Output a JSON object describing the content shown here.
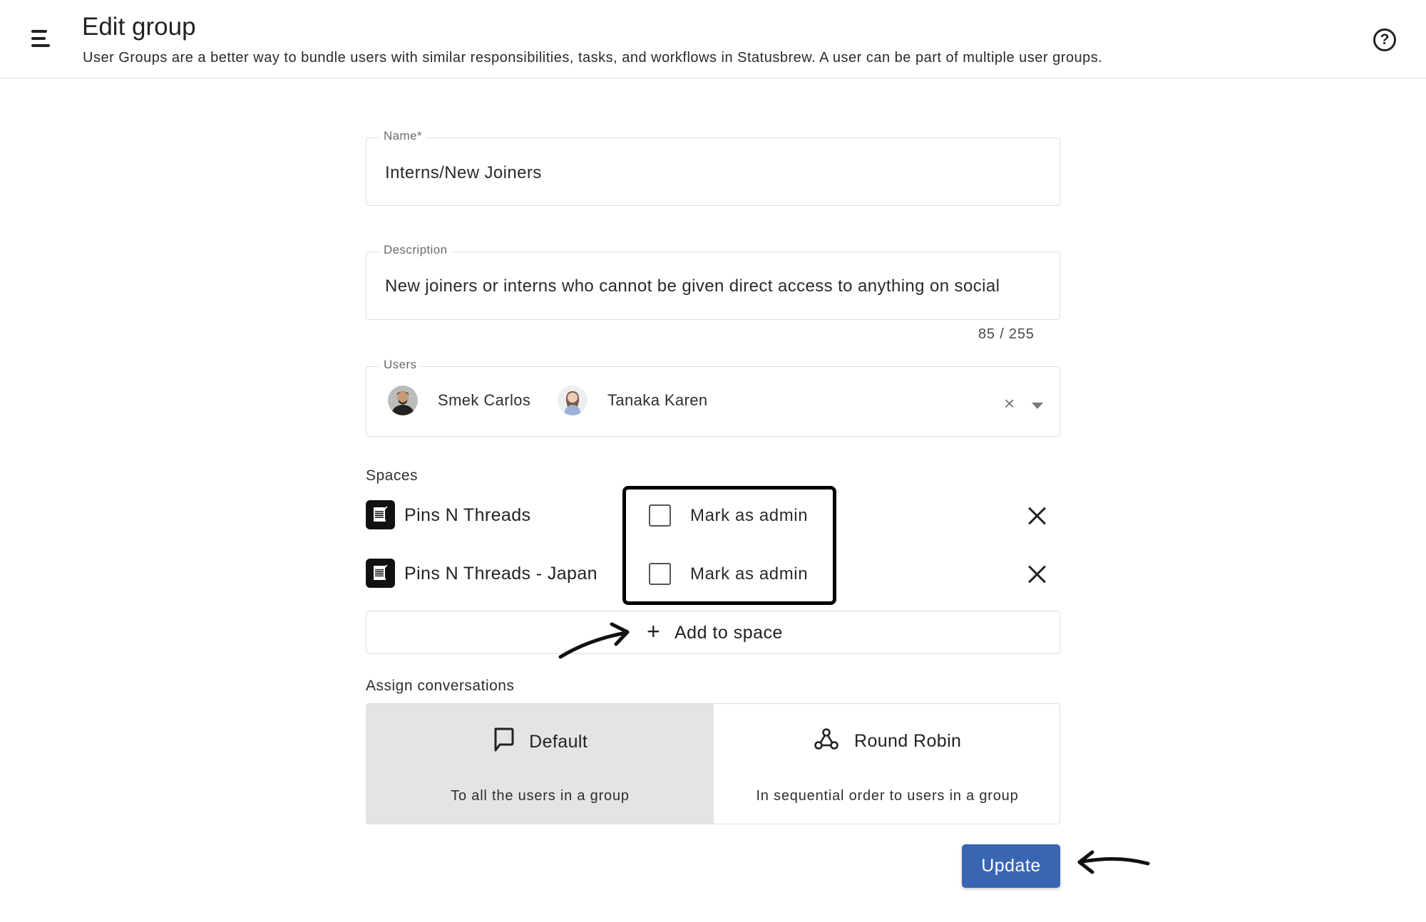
{
  "header": {
    "title": "Edit group",
    "subtitle": "User Groups are a better way to bundle users with similar responsibilities, tasks, and workflows in Statusbrew. A user can be part of multiple user groups.",
    "menu_icon": "hamburger-menu-icon",
    "help_icon": "question-circle-icon",
    "help_glyph": "?"
  },
  "form": {
    "name": {
      "label": "Name*",
      "value": "Interns/New Joiners"
    },
    "description": {
      "label": "Description",
      "value": "New joiners or interns who cannot be given direct access to anything on social",
      "char_count": "85 / 255"
    },
    "users": {
      "label": "Users",
      "clear_glyph": "×",
      "items": [
        {
          "name": "Smek Carlos"
        },
        {
          "name": "Tanaka Karen"
        }
      ]
    },
    "spaces": {
      "label": "Spaces",
      "items": [
        {
          "name": "Pins N Threads",
          "admin_label": "Mark as admin",
          "admin_checked": false
        },
        {
          "name": "Pins N Threads - Japan",
          "admin_label": "Mark as admin",
          "admin_checked": false
        }
      ],
      "add_label": "Add to space",
      "add_glyph": "+"
    },
    "assign": {
      "label": "Assign conversations",
      "options": [
        {
          "title": "Default",
          "description": "To all the users in a group",
          "icon": "chat-bubble-icon",
          "selected": true
        },
        {
          "title": "Round Robin",
          "description": "In sequential order to users in a group",
          "icon": "webhook-icon",
          "selected": false
        }
      ]
    },
    "submit_label": "Update"
  },
  "colors": {
    "primary_button": "#3a65b3",
    "selected_option_bg": "#e4e4e4",
    "highlight_border": "#000000"
  }
}
